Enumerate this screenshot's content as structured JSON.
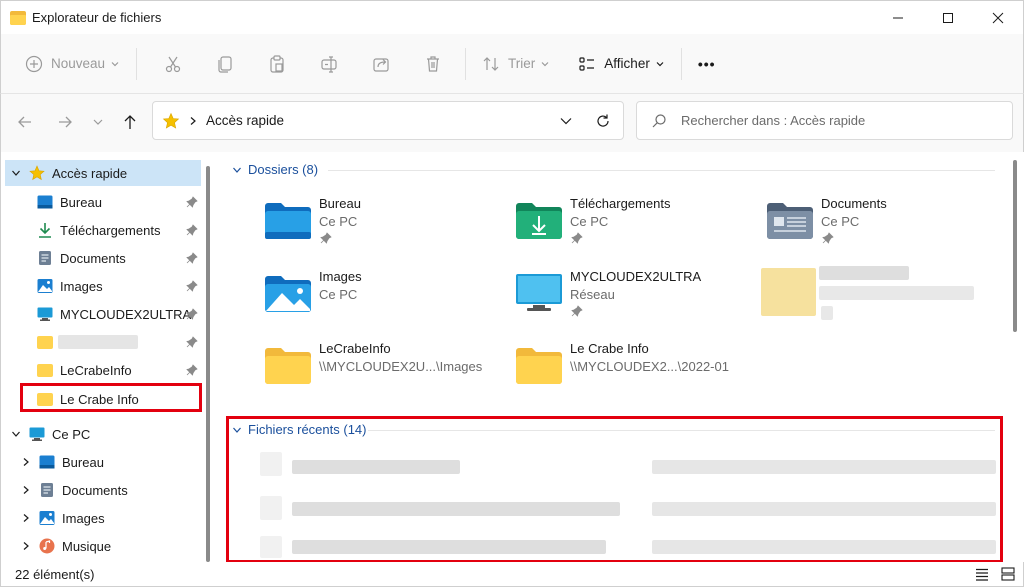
{
  "window": {
    "title": "Explorateur de fichiers"
  },
  "toolbar": {
    "new_label": "Nouveau",
    "sort_label": "Trier",
    "view_label": "Afficher",
    "more_label": "•••"
  },
  "address": {
    "crumb": "Accès rapide"
  },
  "search": {
    "placeholder": "Rechercher dans : Accès rapide"
  },
  "sidebar": {
    "quick_access": "Accès rapide",
    "items": [
      {
        "label": "Bureau",
        "icon": "desktop-icon"
      },
      {
        "label": "Téléchargements",
        "icon": "download-icon"
      },
      {
        "label": "Documents",
        "icon": "documents-icon"
      },
      {
        "label": "Images",
        "icon": "images-icon"
      },
      {
        "label": "MYCLOUDEX2ULTRA",
        "icon": "network-drive-icon"
      },
      {
        "label": "",
        "icon": "folder-icon"
      },
      {
        "label": "LeCrabeInfo",
        "icon": "folder-icon"
      },
      {
        "label": "Le Crabe Info",
        "icon": "folder-icon"
      }
    ],
    "this_pc": "Ce PC",
    "pc_items": [
      {
        "label": "Bureau",
        "icon": "desktop-icon"
      },
      {
        "label": "Documents",
        "icon": "documents-icon"
      },
      {
        "label": "Images",
        "icon": "images-icon"
      },
      {
        "label": "Musique",
        "icon": "music-icon"
      }
    ]
  },
  "main": {
    "folders_header": "Dossiers (8)",
    "recent_header": "Fichiers récents (14)",
    "folders": [
      {
        "name": "Bureau",
        "sub": "Ce PC",
        "icon": "desktop-folder-icon"
      },
      {
        "name": "Téléchargements",
        "sub": "Ce PC",
        "icon": "downloads-folder-icon"
      },
      {
        "name": "Documents",
        "sub": "Ce PC",
        "icon": "documents-folder-icon"
      },
      {
        "name": "Images",
        "sub": "Ce PC",
        "icon": "images-folder-icon"
      },
      {
        "name": "MYCLOUDEX2ULTRA",
        "sub": "Réseau",
        "icon": "network-computer-icon"
      },
      {
        "name": "LeCrabeInfo",
        "sub": "\\\\MYCLOUDEX2U...\\Images",
        "icon": "folder-icon"
      },
      {
        "name": "Le Crabe Info",
        "sub": "\\\\MYCLOUDEX2...\\2022-01",
        "icon": "folder-icon"
      }
    ]
  },
  "status": {
    "count": "22 élément(s)"
  },
  "colors": {
    "accent": "#1a4f9c",
    "highlight": "#e3000f",
    "selection": "#cce4f7",
    "folder": "#ffd34f"
  }
}
